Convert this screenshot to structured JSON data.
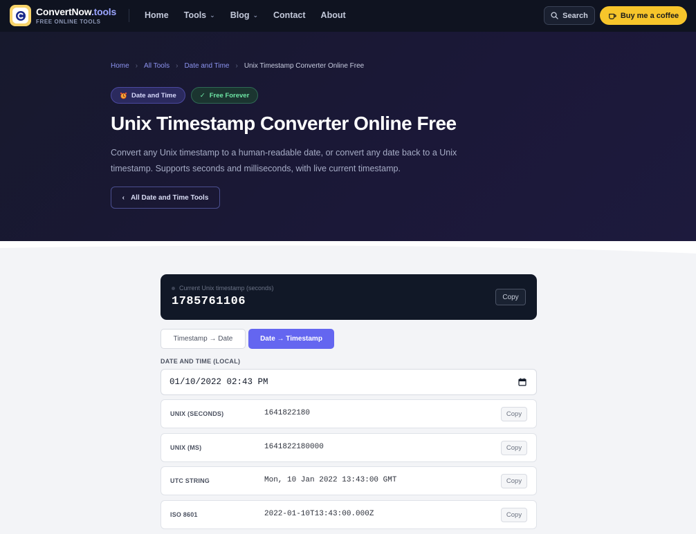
{
  "brand": {
    "name": "ConvertNow",
    "tld": ".tools",
    "tagline": "FREE ONLINE TOOLS",
    "accent": "#9aa4ff",
    "logo_color": "#f7d36a"
  },
  "nav": {
    "links": [
      {
        "label": "Home",
        "dropdown": false
      },
      {
        "label": "Tools",
        "dropdown": true
      },
      {
        "label": "Blog",
        "dropdown": true
      },
      {
        "label": "Contact",
        "dropdown": false
      },
      {
        "label": "About",
        "dropdown": false
      }
    ],
    "search_label": "Search",
    "coffee_label": "Buy me a coffee"
  },
  "breadcrumbs": [
    "Home",
    "All Tools",
    "Date and Time",
    "Unix Timestamp Converter Online Free"
  ],
  "badges": {
    "category": "Date and Time",
    "free": "Free Forever"
  },
  "hero": {
    "title": "Unix Timestamp Converter Online Free",
    "description": "Convert any Unix timestamp to a human-readable date, or convert any date back to a Unix timestamp. Supports seconds and milliseconds, with live current timestamp.",
    "back_label": "All Date and Time Tools"
  },
  "current_ts": {
    "label": "Current Unix timestamp (seconds)",
    "value": "1785761106",
    "copy_label": "Copy"
  },
  "tabs": [
    {
      "label": "Timestamp → Date",
      "active": false
    },
    {
      "label": "Date → Timestamp",
      "active": true
    }
  ],
  "datetime": {
    "label": "DATE AND TIME (LOCAL)",
    "value": "01/10/2022 02:43 PM"
  },
  "results": [
    {
      "key": "UNIX (SECONDS)",
      "value": "1641822180",
      "copy": "Copy"
    },
    {
      "key": "UNIX (MS)",
      "value": "1641822180000",
      "copy": "Copy"
    },
    {
      "key": "UTC STRING",
      "value": "Mon, 10 Jan 2022 13:43:00 GMT",
      "copy": "Copy"
    },
    {
      "key": "ISO 8601",
      "value": "2022-01-10T13:43:00.000Z",
      "copy": "Copy"
    }
  ],
  "colors": {
    "accent": "#6466f0",
    "nav_bg": "#0f1320",
    "coffee": "#f7c52b",
    "free_badge": "#6ee7a5"
  }
}
